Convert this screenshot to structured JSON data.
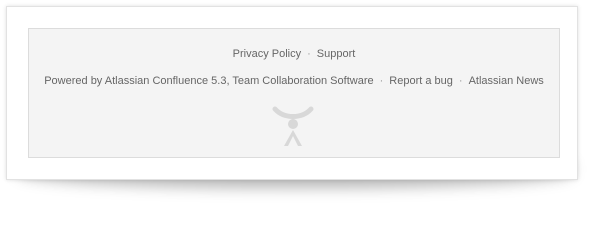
{
  "footer": {
    "row1": {
      "privacy_policy": "Privacy Policy",
      "support": "Support"
    },
    "row2": {
      "powered_by": "Powered by Atlassian Confluence 5.3, Team Collaboration Software",
      "report_bug": "Report a bug",
      "atlassian_news": "Atlassian News"
    },
    "separator": "·",
    "logo_icon": "atlassian-logo-icon"
  }
}
